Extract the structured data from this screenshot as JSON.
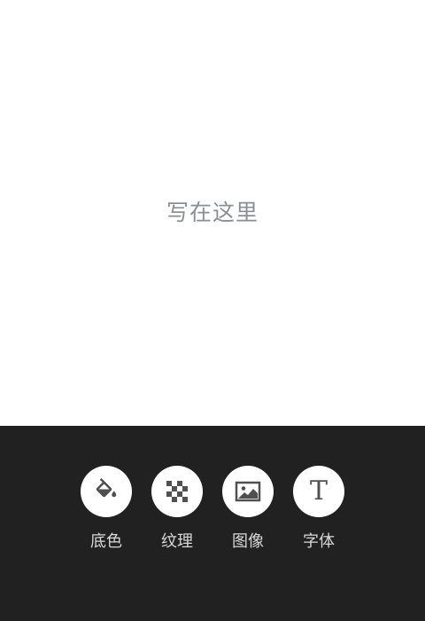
{
  "canvas": {
    "placeholder": "写在这里"
  },
  "toolbar": {
    "items": [
      {
        "label": "底色",
        "icon": "paint-bucket-icon"
      },
      {
        "label": "纹理",
        "icon": "checker-pattern-icon"
      },
      {
        "label": "图像",
        "icon": "image-icon"
      },
      {
        "label": "字体",
        "icon": "font-icon",
        "glyph": "T"
      }
    ]
  },
  "colors": {
    "toolbar_bg": "#212121",
    "icon": "#505050",
    "placeholder_text": "#8a8f93",
    "label_text": "#d9d9d9"
  }
}
